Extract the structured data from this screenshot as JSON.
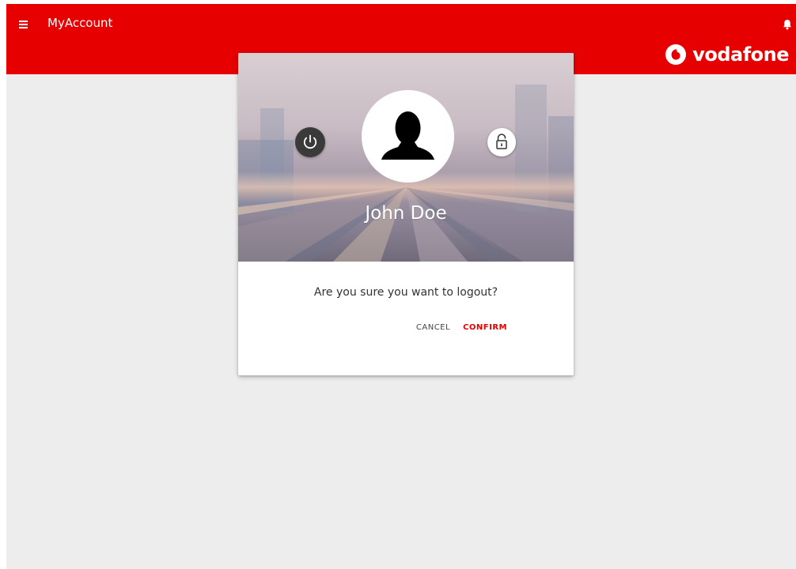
{
  "header": {
    "title": "MyAccount",
    "menu_icon": "hamburger-menu-icon",
    "notification_icon": "bell-icon",
    "brand": "vodafone",
    "brand_color": "#e60000"
  },
  "dialog": {
    "user_name": "John Doe",
    "power_icon": "power-icon",
    "lock_icon": "unlocked-padlock-icon",
    "avatar_icon": "user-silhouette-icon",
    "question": "Are you sure you want to logout?",
    "cancel_label": "CANCEL",
    "confirm_label": "CONFIRM"
  }
}
